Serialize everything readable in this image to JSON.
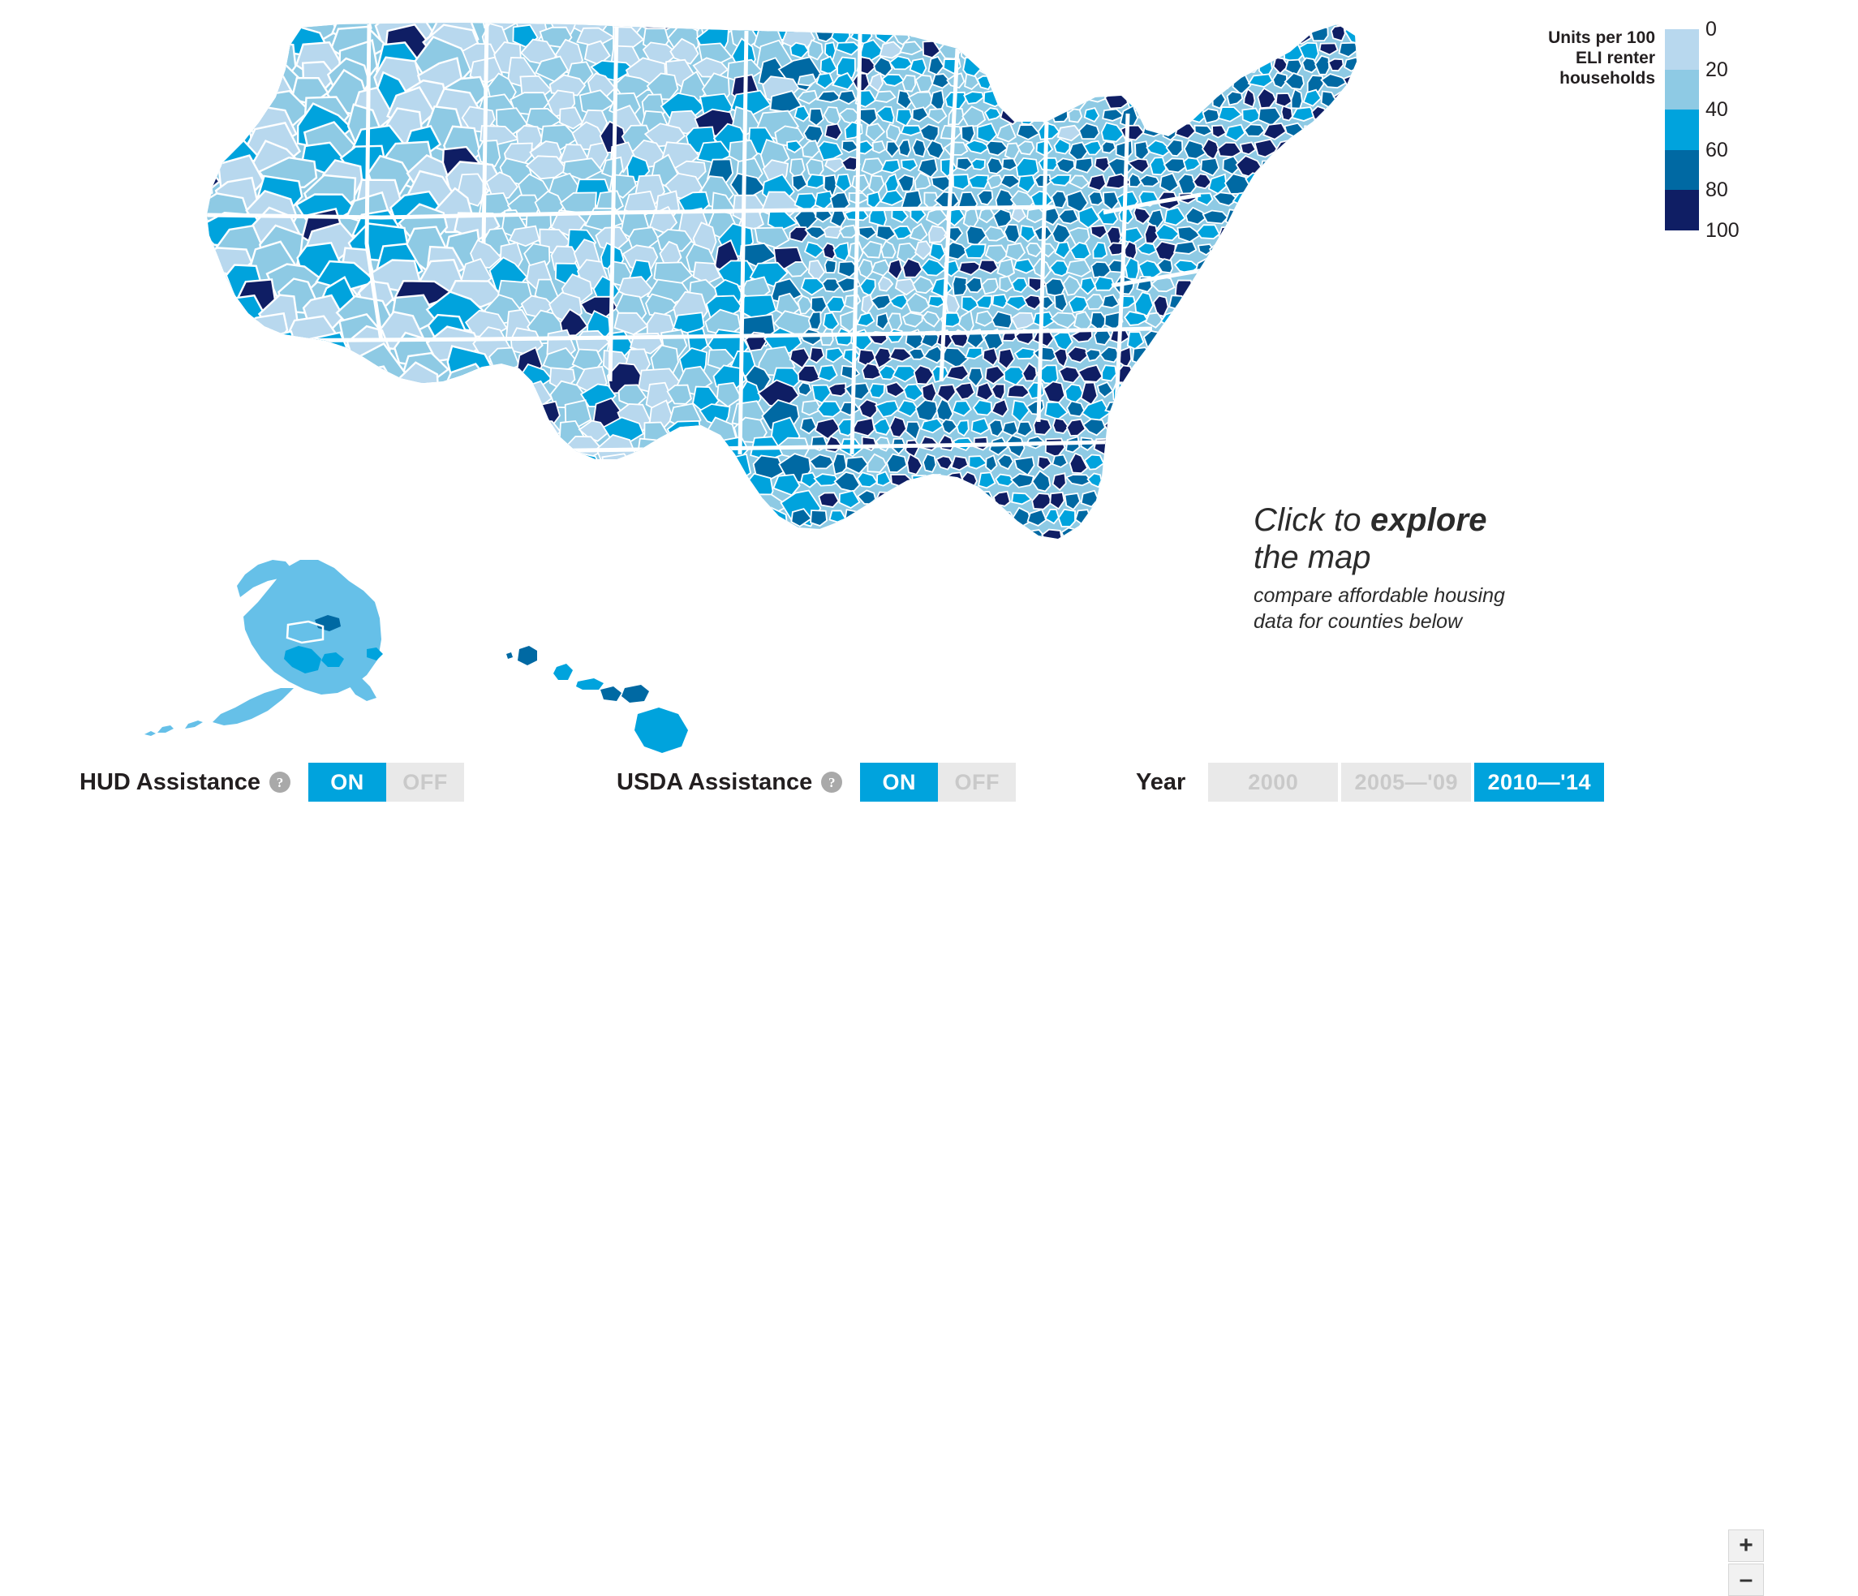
{
  "legend": {
    "title": "Units per 100 ELI renter households",
    "title_lines": [
      "Units per 100",
      "ELI renter",
      "households"
    ],
    "ticks": [
      "0",
      "20",
      "40",
      "60",
      "80",
      "100"
    ],
    "colors": [
      "#b8d8ee",
      "#8ecae4",
      "#00a3dd",
      "#0069a3",
      "#0f1e64"
    ],
    "bins": [
      {
        "from": 0,
        "to": 20,
        "color": "#b8d8ee"
      },
      {
        "from": 20,
        "to": 40,
        "color": "#8ecae4"
      },
      {
        "from": 40,
        "to": 60,
        "color": "#00a3dd"
      },
      {
        "from": 60,
        "to": 80,
        "color": "#0069a3"
      },
      {
        "from": 80,
        "to": 100,
        "color": "#0f1e64"
      }
    ]
  },
  "cta": {
    "line1_plain": "Click to ",
    "line1_bold": "explore",
    "line2": "the map",
    "sub_line1": "compare affordable housing",
    "sub_line2": "data for counties below"
  },
  "controls": {
    "hud": {
      "label": "HUD Assistance",
      "help": "?",
      "on_label": "ON",
      "off_label": "OFF",
      "selected": "ON"
    },
    "usda": {
      "label": "USDA Assistance",
      "help": "?",
      "on_label": "ON",
      "off_label": "OFF",
      "selected": "ON"
    },
    "year": {
      "label": "Year",
      "options": [
        "2000",
        "2005—'09",
        "2010—'14"
      ],
      "selected": "2010—'14"
    },
    "zoom": {
      "in_label": "+",
      "out_label": "–"
    }
  },
  "chart_data": {
    "type": "heatmap",
    "title": "Units per 100 ELI renter households",
    "legend_position": "right",
    "scale_min": 0,
    "scale_max": 100,
    "categories": [
      "0–20",
      "20–40",
      "40–60",
      "60–80",
      "80–100"
    ],
    "colors": [
      "#b8d8ee",
      "#8ecae4",
      "#00a3dd",
      "#0069a3",
      "#0f1e64"
    ],
    "geography": "US counties",
    "insets": [
      "Alaska",
      "Hawaii"
    ]
  }
}
